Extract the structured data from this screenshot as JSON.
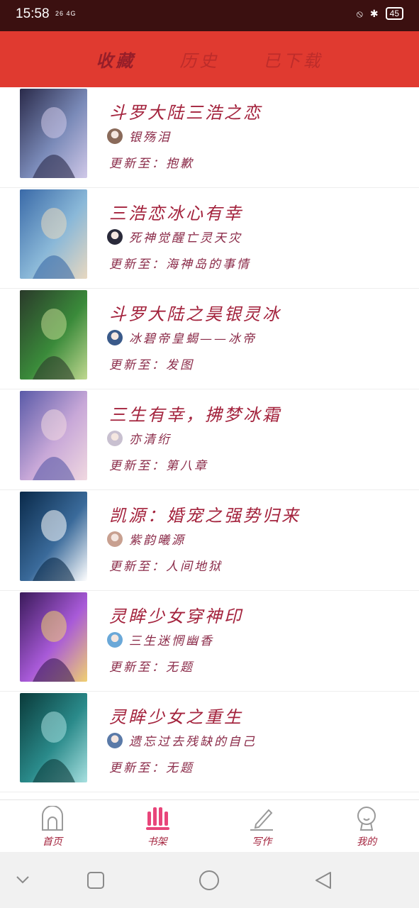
{
  "status": {
    "time": "15:58",
    "signal": "26 4G",
    "battery": "45"
  },
  "header": {
    "tabs": [
      {
        "label": "收藏",
        "active": true
      },
      {
        "label": "历史",
        "active": false
      },
      {
        "label": "已下载",
        "active": false
      }
    ]
  },
  "books": [
    {
      "title": "斗罗大陆三浩之恋",
      "author": "银殇泪",
      "update": "更新至：抱歉",
      "cover_colors": [
        "#2a2a4a",
        "#7a8ab8",
        "#d0c8e8"
      ],
      "avatar_color": "#8a6a5a"
    },
    {
      "title": "三浩恋冰心有幸",
      "author": "死神觉醒亡灵天灾",
      "update": "更新至：海神岛的事情",
      "cover_colors": [
        "#3a6aa8",
        "#8ab8d8",
        "#e8d8c0"
      ],
      "avatar_color": "#2a2a3a"
    },
    {
      "title": "斗罗大陆之昊银灵冰",
      "author": "冰碧帝皇蝎——冰帝",
      "update": "更新至：发图",
      "cover_colors": [
        "#2a3a2a",
        "#3a8a3a",
        "#c0d890"
      ],
      "avatar_color": "#3a5a8a"
    },
    {
      "title": "三生有幸，拂梦冰霜",
      "author": "亦清绗",
      "update": "更新至：第八章",
      "cover_colors": [
        "#5a5aa8",
        "#c8a8d8",
        "#f0d8e0"
      ],
      "avatar_color": "#c8c0d0"
    },
    {
      "title": "凯源：婚宠之强势归来",
      "author": "紫韵曦源",
      "update": "更新至：人间地狱",
      "cover_colors": [
        "#0a2a4a",
        "#3a6a9a",
        "#ffffff"
      ],
      "avatar_color": "#c8a090"
    },
    {
      "title": "灵眸少女穿神印",
      "author": "三生迷惘幽香",
      "update": "更新至：无题",
      "cover_colors": [
        "#3a1a5a",
        "#a85ad8",
        "#f0d070"
      ],
      "avatar_color": "#6aa8d8"
    },
    {
      "title": "灵眸少女之重生",
      "author": "遗忘过去残缺的自己",
      "update": "更新至：无题",
      "cover_colors": [
        "#0a3a3a",
        "#2a8a8a",
        "#a8e0e0"
      ],
      "avatar_color": "#5a7aa8"
    }
  ],
  "nav": {
    "items": [
      {
        "label": "首页",
        "icon": "home-icon"
      },
      {
        "label": "书架",
        "icon": "bookshelf-icon"
      },
      {
        "label": "写作",
        "icon": "pen-icon"
      },
      {
        "label": "我的",
        "icon": "profile-icon"
      }
    ]
  },
  "colors": {
    "header": "#e03a30",
    "accent": "#e8457a",
    "text": "#a3223c"
  }
}
